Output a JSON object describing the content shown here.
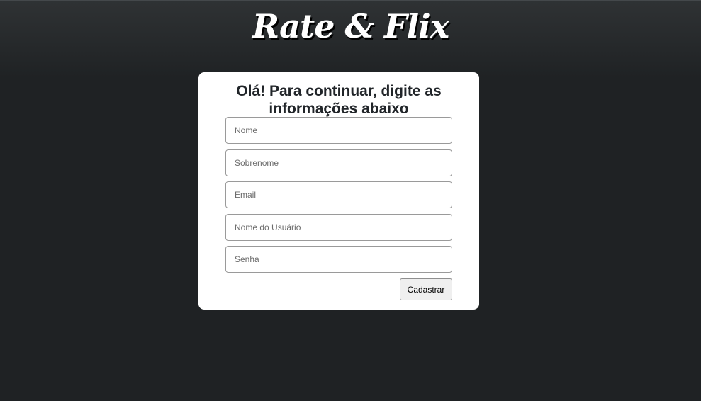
{
  "header": {
    "brand": "Rate & Flix"
  },
  "form": {
    "title": "Olá! Para continuar, digite as informações abaixo",
    "fields": [
      {
        "placeholder": "Nome",
        "value": ""
      },
      {
        "placeholder": "Sobrenome",
        "value": ""
      },
      {
        "placeholder": "Email",
        "value": ""
      },
      {
        "placeholder": "Nome do Usuário",
        "value": ""
      },
      {
        "placeholder": "Senha",
        "value": ""
      }
    ],
    "submit_label": "Cadastrar"
  }
}
